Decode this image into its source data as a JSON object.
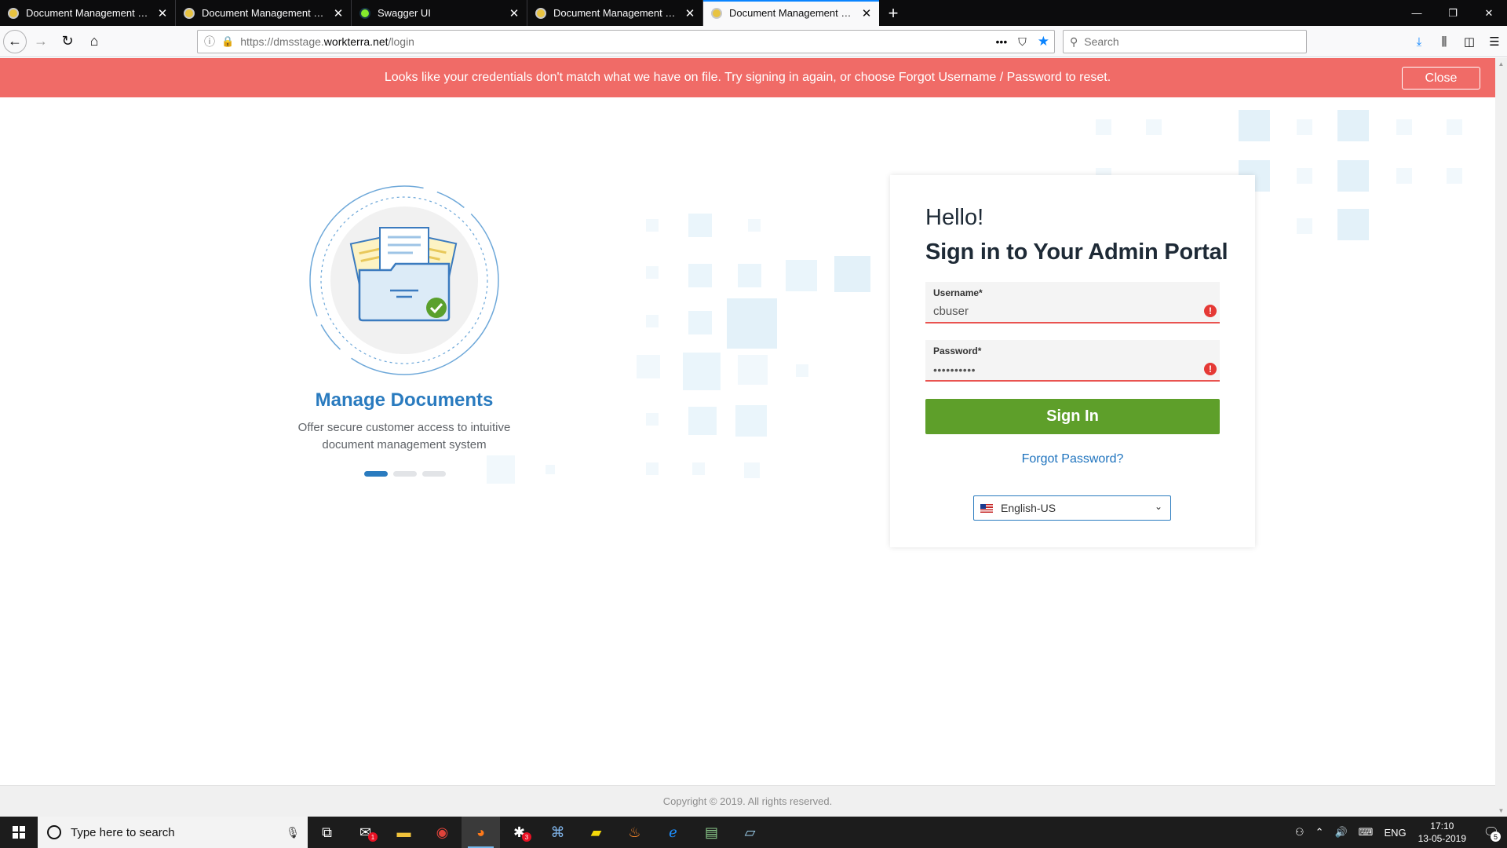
{
  "browser": {
    "tabs": [
      {
        "title": "Document Management Servic",
        "active": false,
        "icon": "site-favicon"
      },
      {
        "title": "Document Management Servic",
        "active": false,
        "icon": "site-favicon"
      },
      {
        "title": "Swagger UI",
        "active": false,
        "icon": "swagger-favicon"
      },
      {
        "title": "Document Management Servic",
        "active": false,
        "icon": "site-favicon"
      },
      {
        "title": "Document Management Servic",
        "active": true,
        "icon": "site-favicon"
      }
    ],
    "url_prefix": "https://dmsstage.",
    "url_host": "workterra.net",
    "url_path": "/login",
    "search_placeholder": "Search"
  },
  "alert": {
    "message": "Looks like your credentials don't match what we have on file. Try signing in again, or choose Forgot Username / Password to reset.",
    "close_label": "Close",
    "color": "#f06b67"
  },
  "slide": {
    "title": "Manage Documents",
    "description_line1": "Offer secure customer access to intuitive",
    "description_line2": "document management system",
    "active_index": 0,
    "count": 3
  },
  "login": {
    "greeting": "Hello!",
    "title": "Sign in to Your Admin Portal",
    "username_label": "Username*",
    "username_value": "cbuser",
    "password_label": "Password*",
    "password_value": "••••••••••",
    "error_icon": "!",
    "signin_label": "Sign In",
    "forgot_label": "Forgot Password?",
    "language": "English-US",
    "accent": "#5e9f2a",
    "link_color": "#1e73be"
  },
  "footer": {
    "copyright": "Copyright © 2019. All rights reserved."
  },
  "taskbar": {
    "search_placeholder": "Type here to search",
    "mail_badge": "1",
    "slack_badge": "3",
    "language": "ENG",
    "time": "17:10",
    "date": "13-05-2019",
    "notification_count": "5"
  }
}
